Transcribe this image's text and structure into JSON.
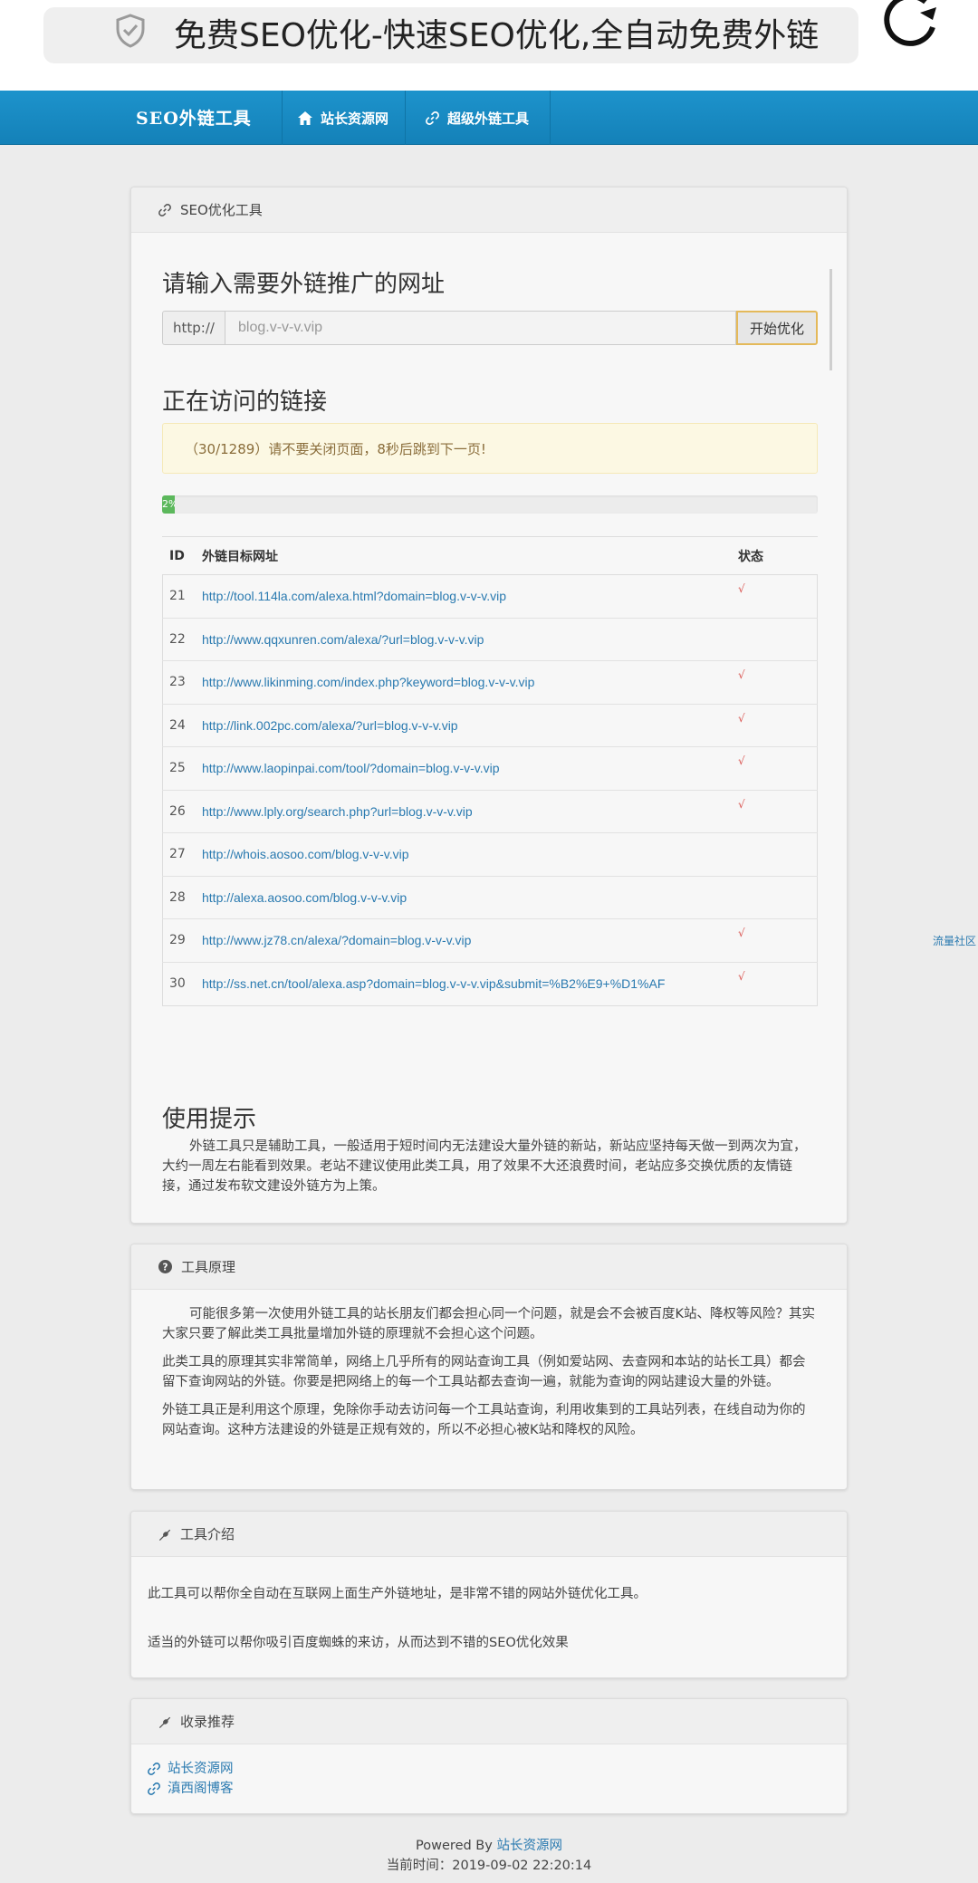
{
  "browser": {
    "url_title": "免费SEO优化-快速SEO优化,全自动免费外链"
  },
  "nav": {
    "brand": "SEO外链工具",
    "items": [
      {
        "label": "站长资源网",
        "icon": "home-icon"
      },
      {
        "label": "超级外链工具",
        "icon": "link-icon"
      }
    ]
  },
  "tool_panel": {
    "title": "SEO优化工具",
    "input_heading": "请输入需要外链推广的网址",
    "addon": "http://",
    "url_value": "blog.v-v-v.vip",
    "start_button": "开始优化",
    "visiting_heading": "正在访问的链接",
    "alert": "（30/1289）请不要关闭页面，8秒后跳到下一页!",
    "progress_percent": 2,
    "progress_label": "2%",
    "table": {
      "headers": [
        "ID",
        "外链目标网址",
        "状态"
      ],
      "rows": [
        {
          "id": "21",
          "url": "http://tool.114la.com/alexa.html?domain=blog.v-v-v.vip",
          "status": "√"
        },
        {
          "id": "22",
          "url": "http://www.qqxunren.com/alexa/?url=blog.v-v-v.vip",
          "status": ""
        },
        {
          "id": "23",
          "url": "http://www.likinming.com/index.php?keyword=blog.v-v-v.vip",
          "status": "√"
        },
        {
          "id": "24",
          "url": "http://link.002pc.com/alexa/?url=blog.v-v-v.vip",
          "status": "√"
        },
        {
          "id": "25",
          "url": "http://www.laopinpai.com/tool/?domain=blog.v-v-v.vip",
          "status": "√"
        },
        {
          "id": "26",
          "url": "http://www.lply.org/search.php?url=blog.v-v-v.vip",
          "status": "√"
        },
        {
          "id": "27",
          "url": "http://whois.aosoo.com/blog.v-v-v.vip",
          "status": ""
        },
        {
          "id": "28",
          "url": "http://alexa.aosoo.com/blog.v-v-v.vip",
          "status": ""
        },
        {
          "id": "29",
          "url": "http://www.jz78.cn/alexa/?domain=blog.v-v-v.vip",
          "status": "√"
        },
        {
          "id": "30",
          "url": "http://ss.net.cn/tool/alexa.asp?domain=blog.v-v-v.vip&submit=%B2%E9+%D1%AF",
          "status": "√"
        }
      ]
    },
    "tips_heading": "使用提示",
    "tips_text": "外链工具只是辅助工具，一般适用于短时间内无法建设大量外链的新站，新站应坚持每天做一到两次为宜，大约一周左右能看到效果。老站不建议使用此类工具，用了效果不大还浪费时间，老站应多交换优质的友情链接，通过发布软文建设外链方为上策。"
  },
  "side_link": "流量社区",
  "principle_panel": {
    "title": "工具原理",
    "paragraphs": [
      "可能很多第一次使用外链工具的站长朋友们都会担心同一个问题，就是会不会被百度K站、降权等风险？其实大家只要了解此类工具批量增加外链的原理就不会担心这个问题。",
      "此类工具的原理其实非常简单，网络上几乎所有的网站查询工具（例如爱站网、去查网和本站的站长工具）都会留下查询网站的外链。你要是把网络上的每一个工具站都去查询一遍，就能为查询的网站建设大量的外链。",
      "外链工具正是利用这个原理，免除你手动去访问每一个工具站查询，利用收集到的工具站列表，在线自动为你的网站查询。这种方法建设的外链是正规有效的，所以不必担心被K站和降权的风险。"
    ]
  },
  "intro_panel": {
    "title": "工具介绍",
    "paragraphs": [
      "此工具可以帮你全自动在互联网上面生产外链地址，是非常不错的网站外链优化工具。",
      "适当的外链可以帮你吸引百度蜘蛛的来访，从而达到不错的SEO优化效果"
    ]
  },
  "recommend_panel": {
    "title": "收录推荐",
    "links": [
      "站长资源网",
      "滇西阁博客"
    ]
  },
  "footer": {
    "powered_prefix": "Powered By",
    "powered_link": "站长资源网",
    "time": "当前时间：2019-09-02 22:20:14"
  },
  "colors": {
    "nav_blue": "#1a8cc4",
    "link_blue": "#2a7ab0",
    "check_red": "#d9534f",
    "progress_green": "#5cb85c"
  }
}
